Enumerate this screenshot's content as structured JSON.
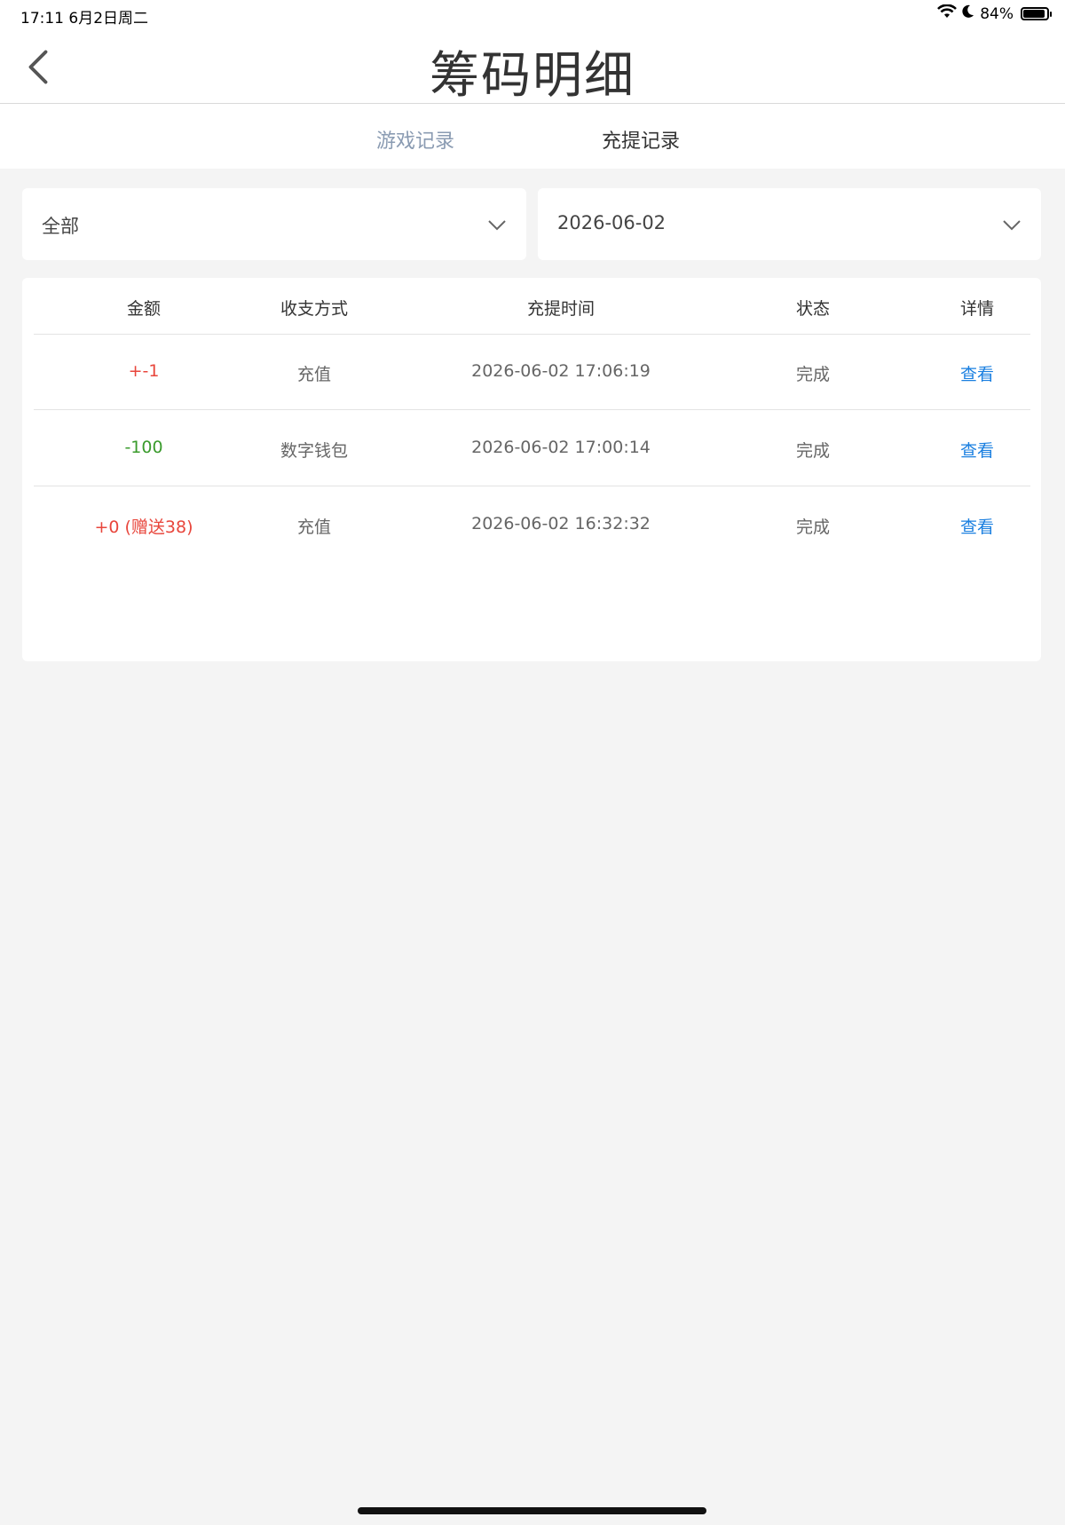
{
  "status_bar": {
    "time": "17:11  6月2日周二",
    "battery_text": "84%",
    "battery_level": 0.84
  },
  "header": {
    "title": "筹码明细"
  },
  "tabs": [
    {
      "label": "游戏记录",
      "active": false
    },
    {
      "label": "充提记录",
      "active": true
    }
  ],
  "filters": {
    "type": {
      "value": "全部"
    },
    "date": {
      "value": "2026-06-02"
    }
  },
  "table": {
    "columns": [
      "金额",
      "收支方式",
      "充提时间",
      "状态",
      "详情"
    ],
    "rows": [
      {
        "amount": "+-1",
        "amount_kind": "positive",
        "method": "充值",
        "time": "2026-06-02 17:06:19",
        "status": "完成",
        "detail": "查看"
      },
      {
        "amount": "-100",
        "amount_kind": "negative",
        "method": "数字钱包",
        "time": "2026-06-02 17:00:14",
        "status": "完成",
        "detail": "查看"
      },
      {
        "amount": "+0 (赠送38)",
        "amount_kind": "positive",
        "method": "充值",
        "time": "2026-06-02 16:32:32",
        "status": "完成",
        "detail": "查看"
      }
    ]
  },
  "colors": {
    "positive": "#e8463c",
    "negative": "#3a9b2c",
    "link": "#1a7fe0",
    "tab_inactive": "#8a9bb2",
    "background": "#f4f4f4"
  }
}
